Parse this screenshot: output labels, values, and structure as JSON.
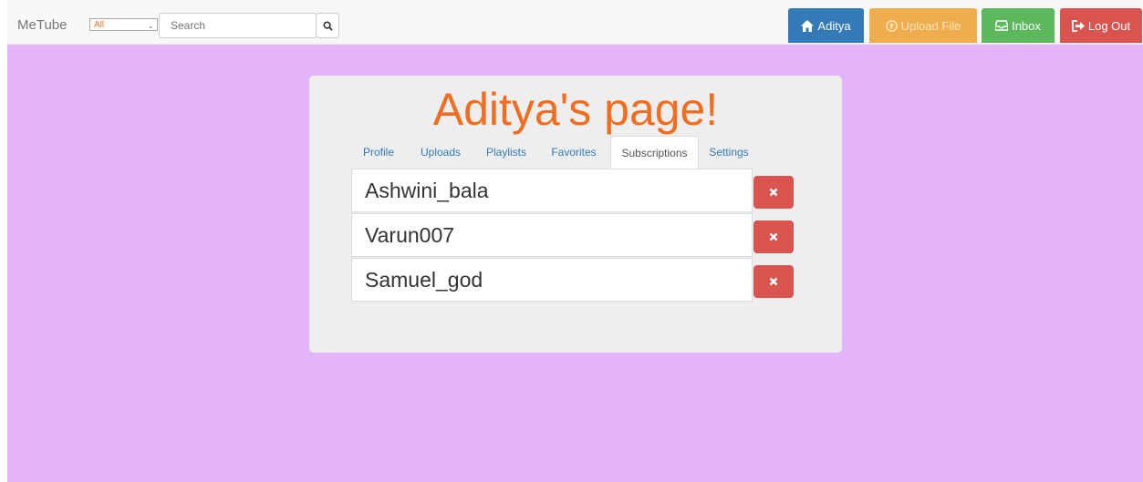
{
  "navbar": {
    "brand": "MeTube",
    "filter_selected": "All",
    "search_placeholder": "Search",
    "home_label": "Aditya",
    "upload_label": "Upload File",
    "inbox_label": "Inbox",
    "logout_label": "Log Out"
  },
  "page": {
    "title": "Aditya's page!",
    "tabs": [
      {
        "label": "Profile"
      },
      {
        "label": "Uploads"
      },
      {
        "label": "Playlists"
      },
      {
        "label": "Favorites"
      },
      {
        "label": "Subscriptions",
        "active": true
      },
      {
        "label": "Settings"
      }
    ],
    "subscriptions": [
      {
        "name": "Ashwini_bala"
      },
      {
        "name": "Varun007"
      },
      {
        "name": "Samuel_god"
      }
    ]
  },
  "colors": {
    "background": "#e4b4fb",
    "title": "#f26d1f",
    "primary": "#337ab7",
    "warning": "#f0ad4e",
    "success": "#5cb85c",
    "danger": "#d9534f"
  },
  "icons": {
    "search": "search-icon",
    "home": "home-icon",
    "upload": "upload-icon",
    "inbox": "inbox-icon",
    "logout": "log-out-icon",
    "remove": "close-icon"
  }
}
